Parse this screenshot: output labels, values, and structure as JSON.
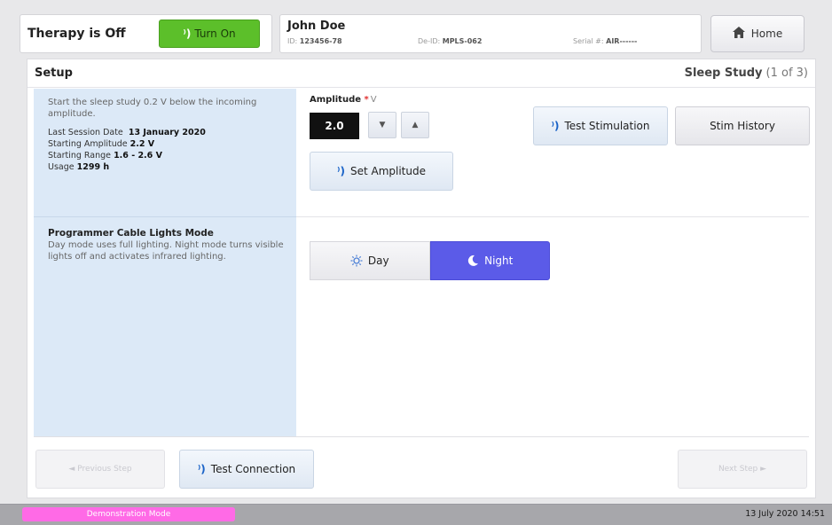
{
  "header": {
    "therapy_status": "Therapy is Off",
    "turn_on_label": "Turn On",
    "patient_name": "John Doe",
    "id_label": "ID:",
    "id_value": "123456-78",
    "deid_label": "De-ID:",
    "deid_value": "MPLS-062",
    "serial_label": "Serial #:",
    "serial_value": "AIR------",
    "home_label": "Home"
  },
  "panel": {
    "title": "Setup",
    "study_title": "Sleep Study",
    "study_progress": "(1 of 3)"
  },
  "sleep_info": {
    "intro": "Start the sleep study 0.2 V below the incoming amplitude.",
    "last_session_label": "Last Session Date",
    "last_session_value": "13 January 2020",
    "starting_amp_label": "Starting Amplitude",
    "starting_amp_value": "2.2 V",
    "starting_range_label": "Starting Range",
    "starting_range_value": "1.6  -  2.6 V",
    "usage_label": "Usage",
    "usage_value": "1299 h"
  },
  "amplitude": {
    "label": "Amplitude",
    "required_mark": "*",
    "unit": "V",
    "value": "2.0",
    "set_label": "Set Amplitude"
  },
  "actions": {
    "test_stimulation": "Test Stimulation",
    "stim_history": "Stim History"
  },
  "lights": {
    "title": "Programmer Cable Lights Mode",
    "description": "Day mode uses full lighting. Night mode turns visible lights off and activates infrared lighting.",
    "day_label": "Day",
    "night_label": "Night",
    "selected": "Night"
  },
  "footer": {
    "previous_label": "◄ Previous Step",
    "test_connection": "Test Connection",
    "next_label": "Next Step ►"
  },
  "statusbar": {
    "mode": "Demonstration Mode",
    "datetime": "13 July 2020 14:51"
  },
  "colors": {
    "turn_on": "#5cbf2a",
    "night_selected": "#5b5be8",
    "left_panel": "#dce9f7",
    "demo_badge": "#ff6ae6"
  },
  "icons": {
    "wireless": "wireless-signal-icon",
    "home": "home-icon",
    "day": "sun-icon",
    "night": "moon-icon",
    "down": "triangle-down-icon",
    "up": "triangle-up-icon"
  }
}
